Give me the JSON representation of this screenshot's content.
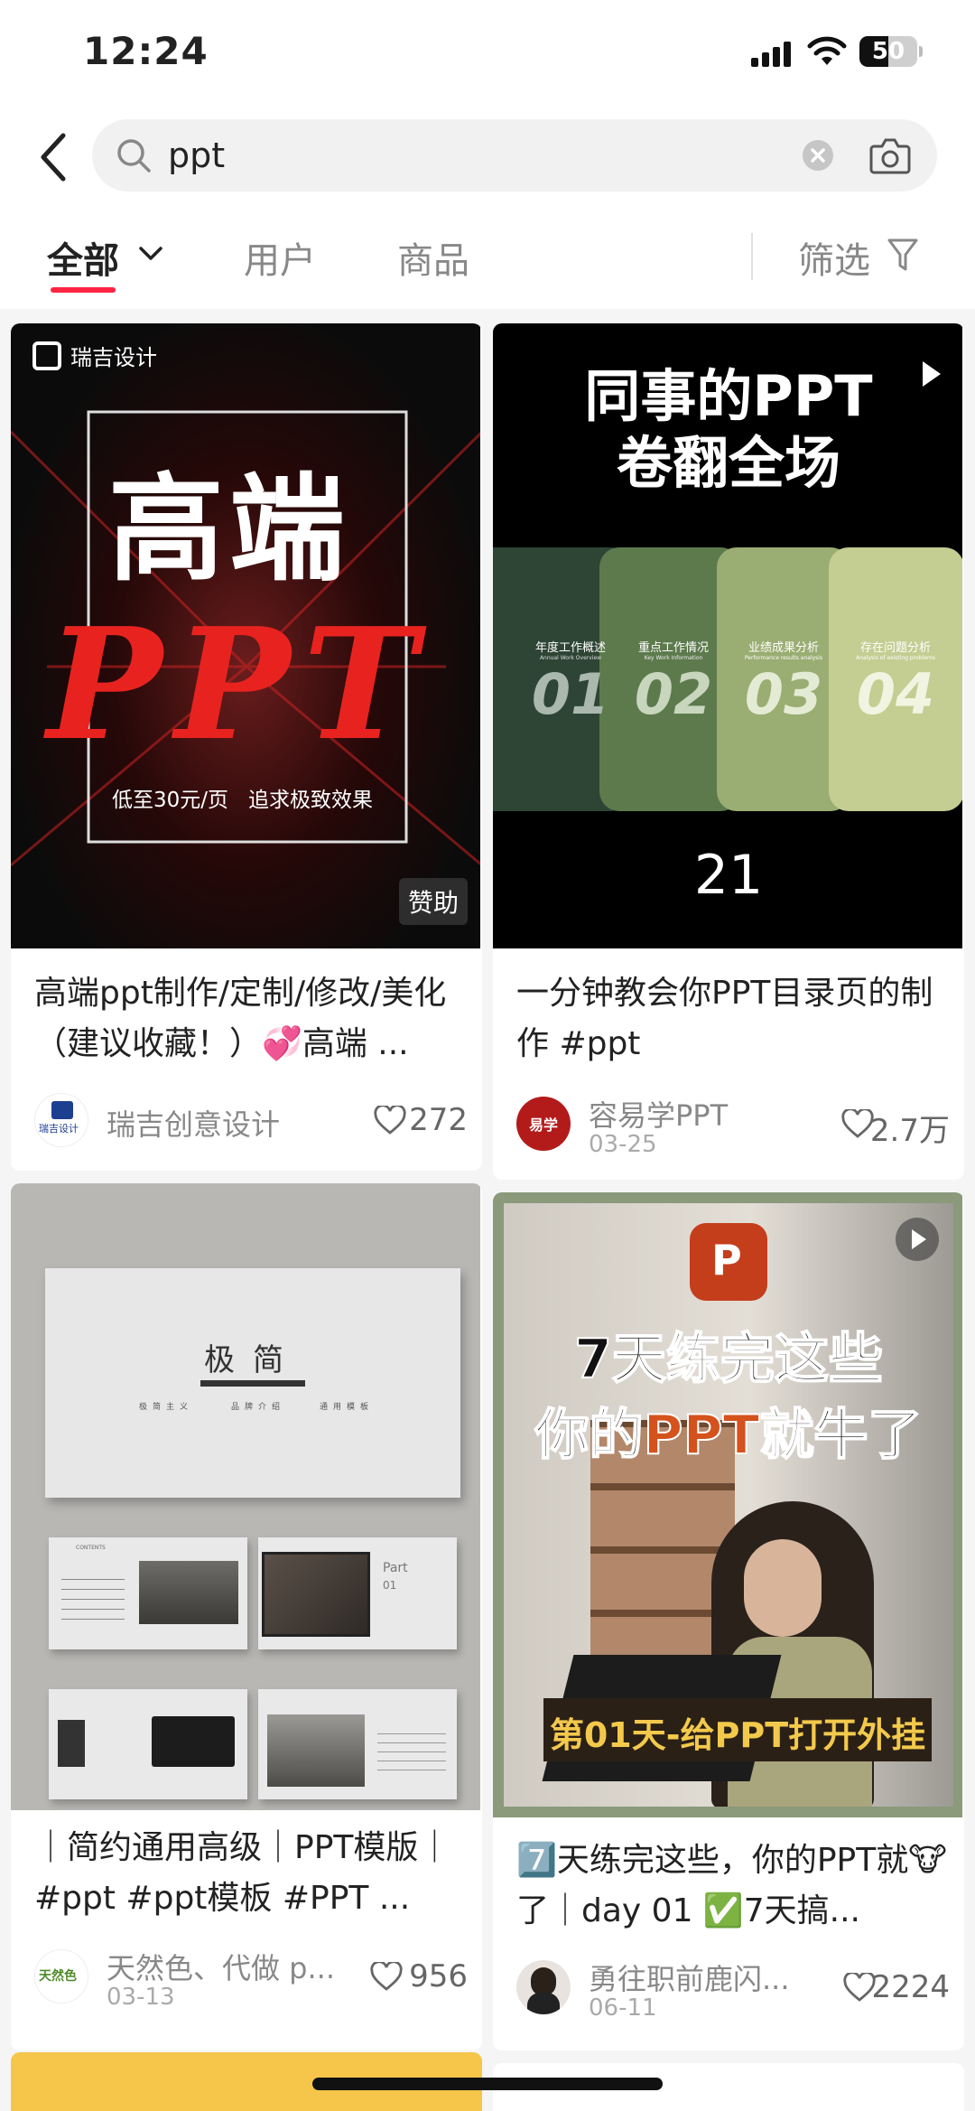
{
  "status": {
    "time": "12:24",
    "battery": "50",
    "battery_level": 0.5
  },
  "search": {
    "query": "ppt"
  },
  "tabs": {
    "all": "全部",
    "users": "用户",
    "goods": "商品",
    "filter": "筛选"
  },
  "colors": {
    "accent": "#ff2442",
    "ppt_red": "#c43e1c"
  },
  "cards": [
    {
      "image": {
        "brand": "瑞吉设计",
        "headline": "高端",
        "big": "PPT",
        "slogan": "低至30元/页   追求极致效果",
        "sponsor": "赞助"
      },
      "title": "高端ppt制作/定制/修改/美化（建议收藏！）💞高端 ...",
      "author": "瑞吉创意设计",
      "avatar_text": "瑞吉设计",
      "likes": "272"
    },
    {
      "image": {
        "line1": "同事的PPT",
        "line2": "卷翻全场",
        "panels": [
          {
            "num": "01",
            "label": "年度工作概述",
            "sub": "Annual Work Overview"
          },
          {
            "num": "02",
            "label": "重点工作情况",
            "sub": "Key Work Information"
          },
          {
            "num": "03",
            "label": "业绩成果分析",
            "sub": "Performance results analysis"
          },
          {
            "num": "04",
            "label": "存在问题分析",
            "sub": "Analysis of existing problems"
          }
        ],
        "page": "21"
      },
      "title": "一分钟教会你PPT目录页的制作 #ppt",
      "author": "容易学PPT",
      "date": "03-25",
      "avatar_text": "易学",
      "likes": "2.7万"
    },
    {
      "image": {
        "title": "极简",
        "sub1": "极简主义",
        "sub2": "品牌介绍",
        "sub3": "通用模板",
        "part": "Part",
        "part_num": "01",
        "contents": "CONTENTS"
      },
      "title": "｜简约通用高级｜PPT模版｜#ppt  #ppt模板  #PPT ...",
      "author": "天然色、代做 p...",
      "date": "03-13",
      "avatar_text": "天然色",
      "likes": "956"
    },
    {
      "image": {
        "line1": "7天练完这些",
        "line2a": "你的",
        "line2b": "PPT",
        "line2c": "就牛了",
        "banner": "第01天-给PPT打开外挂"
      },
      "title": "7️⃣天练完这些，你的PPT就🐮了｜day 01 ✅7天搞...",
      "author": "勇往职前鹿闪...",
      "date": "06-11",
      "likes": "2224"
    }
  ]
}
